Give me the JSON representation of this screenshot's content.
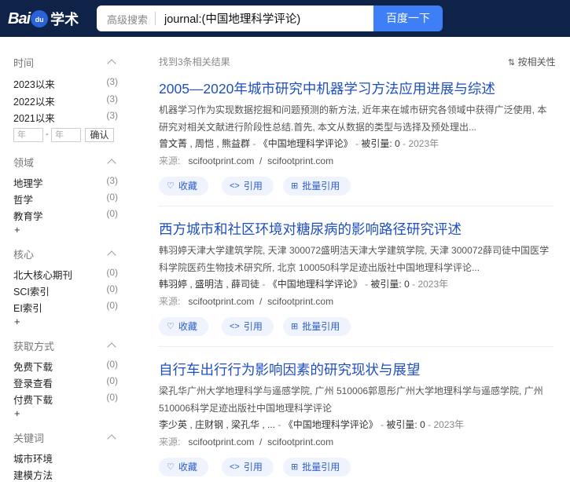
{
  "header": {
    "logo_bai": "Bai",
    "logo_du": "du",
    "logo_xueshu": "学术",
    "advanced_search": "高级搜索",
    "query": "journal:(中国地理科学评论)",
    "search_button": "百度一下"
  },
  "sidebar": {
    "time": {
      "title": "时间",
      "items": [
        {
          "label": "2023以来",
          "count": "(3)"
        },
        {
          "label": "2022以来",
          "count": "(3)"
        },
        {
          "label": "2021以来",
          "count": "(3)"
        }
      ],
      "year_from_placeholder": "年",
      "year_to_placeholder": "年",
      "confirm": "确认"
    },
    "field": {
      "title": "领域",
      "items": [
        {
          "label": "地理学",
          "count": "(3)"
        },
        {
          "label": "哲学",
          "count": "(0)"
        },
        {
          "label": "教育学",
          "count": "(0)"
        }
      ],
      "more": "+"
    },
    "core": {
      "title": "核心",
      "items": [
        {
          "label": "北大核心期刊",
          "count": "(0)"
        },
        {
          "label": "SCI索引",
          "count": "(0)"
        },
        {
          "label": "EI索引",
          "count": "(0)"
        }
      ],
      "more": "+"
    },
    "access": {
      "title": "获取方式",
      "items": [
        {
          "label": "免费下载",
          "count": "(0)"
        },
        {
          "label": "登录查看",
          "count": "(0)"
        },
        {
          "label": "付费下载",
          "count": "(0)"
        }
      ],
      "more": "+"
    },
    "keywords": {
      "title": "关键词",
      "items": [
        {
          "label": "城市环境"
        },
        {
          "label": "建模方法"
        }
      ]
    }
  },
  "main": {
    "found_text": "找到3条相关结果",
    "sort_label": "按相关性",
    "results": [
      {
        "title": "2005—2020年城市研究中机器学习方法应用进展与综述",
        "abstract": "机器学习作为实现数据挖掘和问题预测的新方法, 近年来在城市研究各领域中获得广泛使用, 本研究对相关文献进行阶段性总结.首先, 本文从数据的类型与选择及预处理出...",
        "authors": "曾文菁 ,  周恺 ,  熊益群",
        "journal": "《中国地理科学评论》",
        "cited": "被引量: 0",
        "year": "2023年",
        "source_label": "来源:",
        "source1": "scifootprint.com",
        "source2": "scifootprint.com"
      },
      {
        "title": "西方城市和社区环境对糖尿病的影响路径研究评述",
        "abstract": "韩羽婷天津大学建筑学院, 天津 300072盛明洁天津大学建筑学院, 天津 300072薛司徒中国医学科学院医药生物技术研究所, 北京 100050科学足迹出版社中国地理科学评论...",
        "authors": "韩羽婷 ,  盛明洁 ,  薛司徒",
        "journal": "《中国地理科学评论》",
        "cited": "被引量: 0",
        "year": "2023年",
        "source_label": "来源:",
        "source1": "scifootprint.com",
        "source2": "scifootprint.com"
      },
      {
        "title": "自行车出行行为影响因素的研究现状与展望",
        "abstract": "梁孔华广州大学地理科学与遥感学院, 广州 510006郭恩彤广州大学地理科学与遥感学院, 广州 510006科学足迹出版社中国地理科学评论",
        "authors": "李少英 ,  庄财钢 ,  梁孔华 ,  ...",
        "journal": "《中国地理科学评论》",
        "cited": "被引量: 0",
        "year": "2023年",
        "source_label": "来源:",
        "source1": "scifootprint.com",
        "source2": "scifootprint.com"
      }
    ],
    "actions": {
      "favorite": "收藏",
      "cite": "引用",
      "batch_cite": "批量引用"
    }
  }
}
